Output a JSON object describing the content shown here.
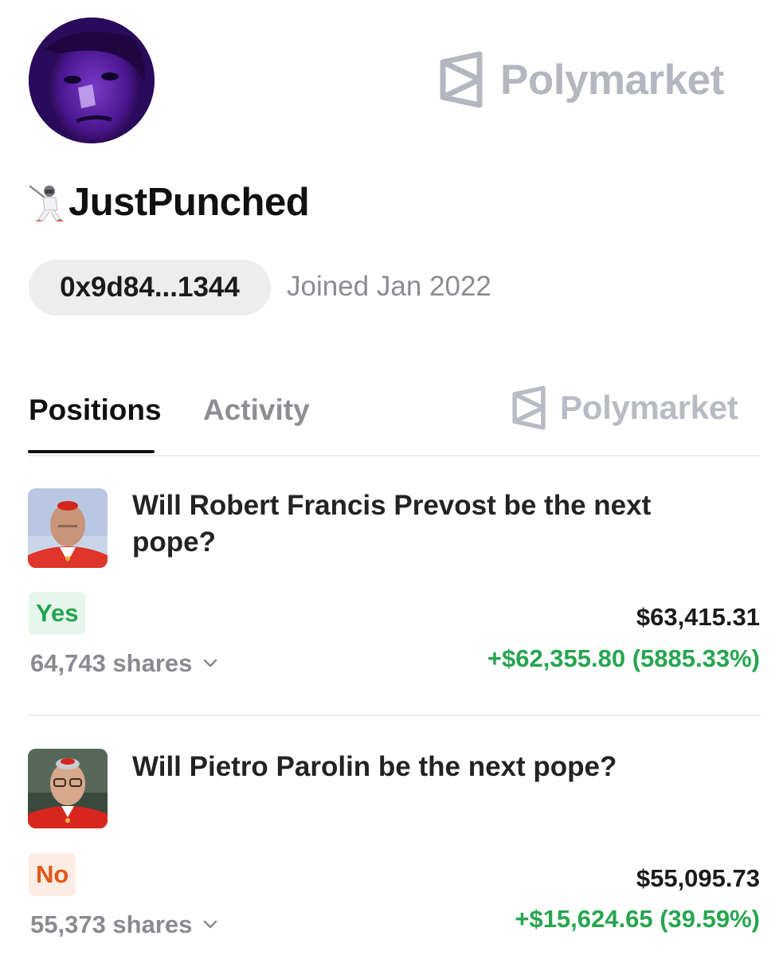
{
  "profile": {
    "username": "JustPunched",
    "address": "0x9d84...1344",
    "joined": "Joined Jan 2022",
    "avatar_icon": "profile-photo",
    "badge_icon": "fencer-icon"
  },
  "brand": {
    "name": "Polymarket",
    "logo_icon": "polymarket-logo-icon",
    "color": "#b4b6c0"
  },
  "tabs": [
    {
      "label": "Positions",
      "active": true
    },
    {
      "label": "Activity",
      "active": false
    }
  ],
  "positions": [
    {
      "title": "Will Robert Francis Prevost be the next pope?",
      "outcome": "Yes",
      "shares": "64,743 shares",
      "value": "$63,415.31",
      "pnl": "+$62,355.80 (5885.33%)"
    },
    {
      "title": "Will Pietro Parolin be the next pope?",
      "outcome": "No",
      "shares": "55,373 shares",
      "value": "$55,095.73",
      "pnl": "+$15,624.65 (39.59%)"
    }
  ],
  "colors": {
    "yes": "#21a54e",
    "no": "#e3561a",
    "gain": "#27a550",
    "muted": "#8a8a91"
  }
}
